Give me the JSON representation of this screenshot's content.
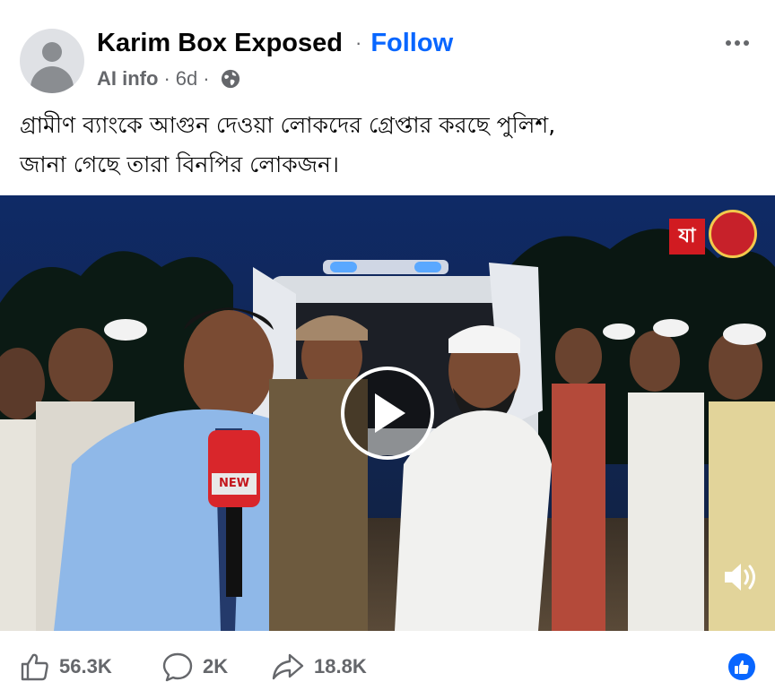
{
  "post": {
    "page_name": "Karim Box Exposed",
    "follow_label": "Follow",
    "ai_info_label": "AI info",
    "time_ago": "6d",
    "separator": "·",
    "caption_line1": "গ্রামীণ ব্যাংকে আগুন দেওয়া লোকদের গ্রেপ্তার করছে পুলিশ,",
    "caption_line2": "জানা গেছে তারা বিনপির লোকজন।"
  },
  "video": {
    "mic_label": "NEW",
    "watermark_text": "যা"
  },
  "actions": {
    "likes": "56.3K",
    "comments": "2K",
    "shares": "18.8K"
  },
  "icons": {
    "privacy": "globe-icon",
    "menu": "more-options-icon",
    "play": "play-icon",
    "sound": "volume-icon",
    "like": "thumbs-up-icon",
    "comment": "comment-icon",
    "share": "share-icon",
    "reaction": "like-reaction-icon"
  },
  "colors": {
    "accent": "#0866ff",
    "secondary_text": "#65676b"
  }
}
